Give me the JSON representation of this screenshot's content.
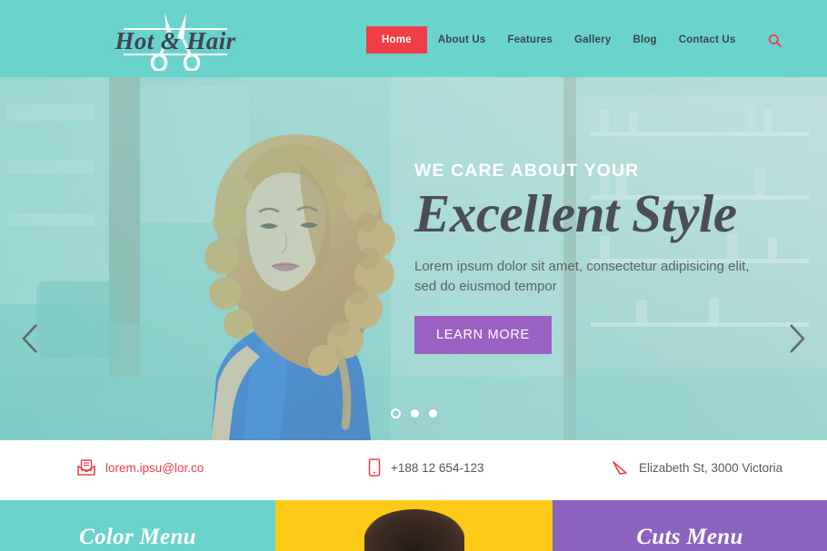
{
  "header": {
    "logo": {
      "text": "Hot & Hair",
      "icon": "scissors-icon",
      "bg_color": "#6bd3cd"
    },
    "nav": [
      {
        "label": "Home",
        "active": true
      },
      {
        "label": "About Us",
        "active": false
      },
      {
        "label": "Features",
        "active": false
      },
      {
        "label": "Gallery",
        "active": false
      },
      {
        "label": "Blog",
        "active": false
      },
      {
        "label": "Contact Us",
        "active": false
      }
    ],
    "search_icon": "search-icon",
    "active_color": "#ef3e46"
  },
  "hero": {
    "kicker": "WE CARE ABOUT YOUR",
    "title": "Excellent Style",
    "subtitle": "Lorem ipsum dolor sit amet, consectetur adipisicing elit, sed do eiusmod tempor",
    "cta_label": "LEARN MORE",
    "cta_color": "#9b62c4",
    "prev_icon": "chevron-left-icon",
    "next_icon": "chevron-right-icon",
    "slides": [
      {
        "index": 1,
        "active": true
      },
      {
        "index": 2,
        "active": false
      },
      {
        "index": 3,
        "active": false
      }
    ]
  },
  "contact": {
    "email": {
      "icon": "envelope-icon",
      "value": "lorem.ipsu@lor.co"
    },
    "phone": {
      "icon": "mobile-phone-icon",
      "value": "+188 12 654-123"
    },
    "address": {
      "icon": "location-pin-icon",
      "value": "Elizabeth St, 3000 Victoria"
    },
    "accent_color": "#ef3e46"
  },
  "cards": [
    {
      "title": "Color Menu",
      "color": "#6bd3cd"
    },
    {
      "title": "",
      "color": "#fdca17"
    },
    {
      "title": "Cuts Menu",
      "color": "#8b63bf"
    }
  ]
}
